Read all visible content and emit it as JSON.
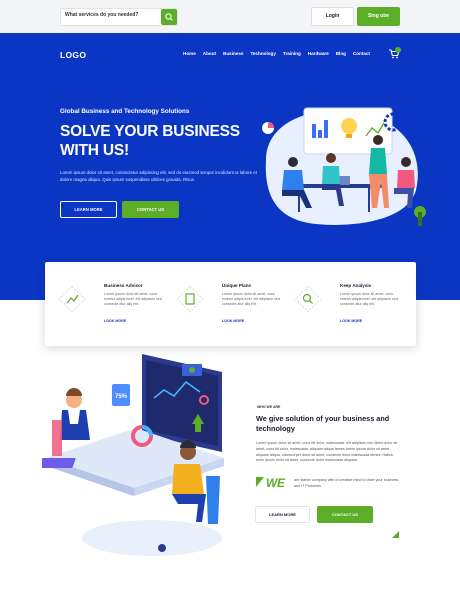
{
  "topbar": {
    "search_placeholder": "What services do you needed?",
    "login_label": "Login",
    "signup_label": "Sing ube"
  },
  "header": {
    "logo": "LOGO",
    "nav": [
      "Home",
      "About",
      "Business",
      "Technology",
      "Training",
      "Hardware",
      "Blog",
      "Contact"
    ]
  },
  "hero": {
    "subtitle": "Global Business and Technology Solutions",
    "title": "SOLVE YOUR BUSINESS WITH US!",
    "text": "Lorem ipsum dolor sit amet, consectetur adipiscing elit, sed do eiusmod tempor incididunt ut labore et dolore magna aliqua. Quis ipsum suspendisse ultrices gravida. Risus",
    "learn_label": "LEARN MORE",
    "contact_label": "CONTACT US"
  },
  "services": [
    {
      "title": "Business Advisor",
      "text": "Lorem ipsum dolor sit amet, cons ectetur adipis iscel. elit adipiscin sed consecte atur aliq elit.",
      "link": "LOOK MORE"
    },
    {
      "title": "Unique Plans",
      "text": "Lorem ipsum dolor sit amet, cons ectetur adipis iscel. elit adipiscin sed consecte atur aliq elit.",
      "link": "LOOK MORE"
    },
    {
      "title": "Keep Analysis",
      "text": "Lorem ipsum dolor sit amet, cons ectetur adipis iscel. elit adipiscin sed consecte atur aliq elit.",
      "link": "LOOK MORE"
    }
  ],
  "about": {
    "tag": "WHO WE ARE",
    "title": "We give solution of your business and technology",
    "text": "Lorem ipsum dolor sit amet, cons litt dolor, malesuada. elit adipiscin nec libero dolor sit amet, cons litt dolor, malesuada. aliquam aliqua fames lorem ipsum dolor sit amet. aliquam aliqua, ullamcorper dolor sit amet, consecte dolor malesuada fames. Hatics, enim ipsum dolor sit amet, consecte dolor malesuada aliquam.",
    "we": "WE",
    "we_text": "are starter company with of creative mind to drive your business and IT Problems",
    "learn_label": "LEARN MORE",
    "contact_label": "CONTACT US"
  },
  "colors": {
    "brand_blue": "#0b36c4",
    "accent_green": "#5cae28"
  }
}
